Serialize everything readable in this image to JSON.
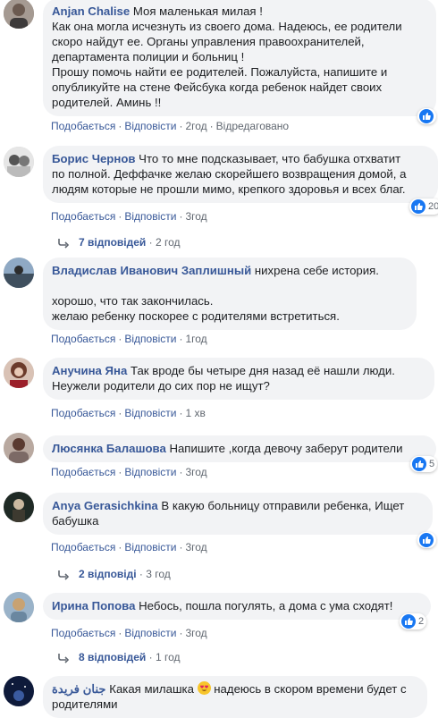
{
  "comments": [
    {
      "name": "Anjan Chalise",
      "text_lines": [
        "Моя маленькая милая !",
        "Как она могла исчезнуть из своего дома. Надеюсь, ее родители",
        "скоро найдут ее. Органы управления правоохранителей,",
        "департамента полиции и больниц !",
        "Прошу помочь найти ее родителей. Пожалуйста, напишите и",
        "опубликуйте на стене Фейсбука когда ребенок найдет своих",
        "родителей. Аминь !!"
      ],
      "like": "Подобається",
      "reply": "Відповісти",
      "time": "2год",
      "edited": "Відредаговано",
      "reaction_count": ""
    },
    {
      "name": "Борис Чернов",
      "text_lines": [
        "Что то мне подсказывает, что бабушка отхватит",
        "по полной. Деффачке желаю скорейшего возвращения домой, а",
        "людям которые не прошли мимо, крепкого здоровья и всех благ."
      ],
      "like": "Подобається",
      "reply": "Відповісти",
      "time": "3год",
      "reaction_count": "20",
      "replies": "7 відповідей",
      "replies_time": "2 год"
    },
    {
      "name": "Владислав Иванович Заплишный",
      "text_lines": [
        "нихрена себе история.",
        "",
        "хорошо, что так закончилась.",
        "желаю ребенку поскорее с родителями встретиться."
      ],
      "like": "Подобається",
      "reply": "Відповісти",
      "time": "1год"
    },
    {
      "name": "Анучина Яна",
      "text_lines": [
        "Так вроде бы четыре дня назад её нашли люди.",
        "Неужели родители до сих пор не ищут?"
      ],
      "like": "Подобається",
      "reply": "Відповісти",
      "time": "1 хв"
    },
    {
      "name": "Люсянка Балашова",
      "text_lines": [
        "Напишите ,когда девочу заберут родители"
      ],
      "like": "Подобається",
      "reply": "Відповісти",
      "time": "3год",
      "reaction_count": "5"
    },
    {
      "name": "Anya Gerasichkina",
      "text_lines": [
        "В какую больницу отправили ребенка, Ищет",
        "бабушка"
      ],
      "like": "Подобається",
      "reply": "Відповісти",
      "time": "3год",
      "reaction_count": "",
      "replies": "2 відповіді",
      "replies_time": "3 год"
    },
    {
      "name": "Ирина Попова",
      "text_lines": [
        "Небось, пошла погулять, а дома с ума сходят!"
      ],
      "like": "Подобається",
      "reply": "Відповісти",
      "time": "3год",
      "reaction_count": "2",
      "replies": "8 відповідей",
      "replies_time": "1 год"
    },
    {
      "name": "جنان فريدة",
      "text_before_emoji": "Какая милашка",
      "text_after_emoji": "надеюсь в скором времени будет с",
      "text_line2": "родителями"
    }
  ],
  "colors": {
    "link": "#385898",
    "bubble": "#f2f3f5",
    "meta": "#606770",
    "like": "#1877f2"
  },
  "icons": [
    "like-icon",
    "reply-arrow-icon",
    "heart-eyes-emoji-icon"
  ]
}
